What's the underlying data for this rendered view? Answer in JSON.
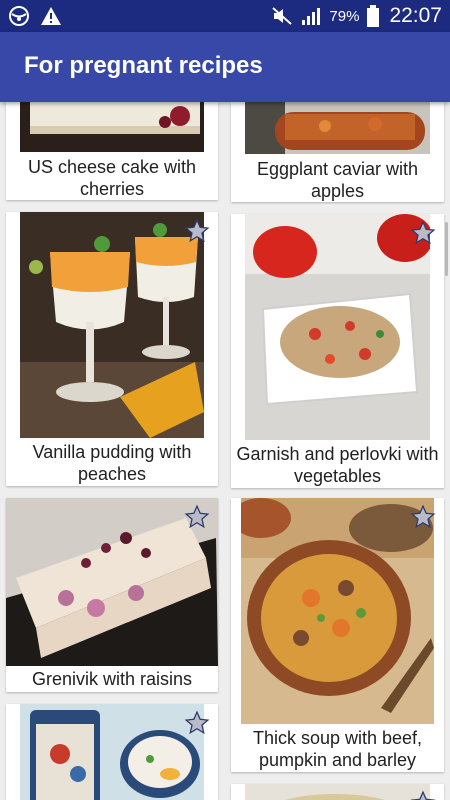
{
  "status_bar": {
    "left_icons": [
      "app-notification-icon",
      "warning-icon"
    ],
    "right_icons": [
      "mute-icon",
      "signal-icon",
      "battery-icon"
    ],
    "battery": "79%",
    "time": "22:07"
  },
  "app_bar": {
    "title": "For pregnant recipes"
  },
  "recipes": [
    {
      "name": "US cheese cake with cherries",
      "favorite_icon": "star-outline-icon"
    },
    {
      "name": "Eggplant caviar with apples",
      "favorite_icon": "star-outline-icon"
    },
    {
      "name": "Vanilla pudding with peaches",
      "favorite_icon": "star-outline-icon"
    },
    {
      "name": "Garnish and perlovki with vegetables",
      "favorite_icon": "star-outline-icon"
    },
    {
      "name": "Grenivik with raisins",
      "favorite_icon": "star-outline-icon"
    },
    {
      "name": "Thick soup with beef, pumpkin and barley",
      "favorite_icon": "star-outline-icon"
    },
    {
      "name": "",
      "favorite_icon": "star-outline-icon"
    },
    {
      "name": "",
      "favorite_icon": "star-outline-icon"
    }
  ]
}
